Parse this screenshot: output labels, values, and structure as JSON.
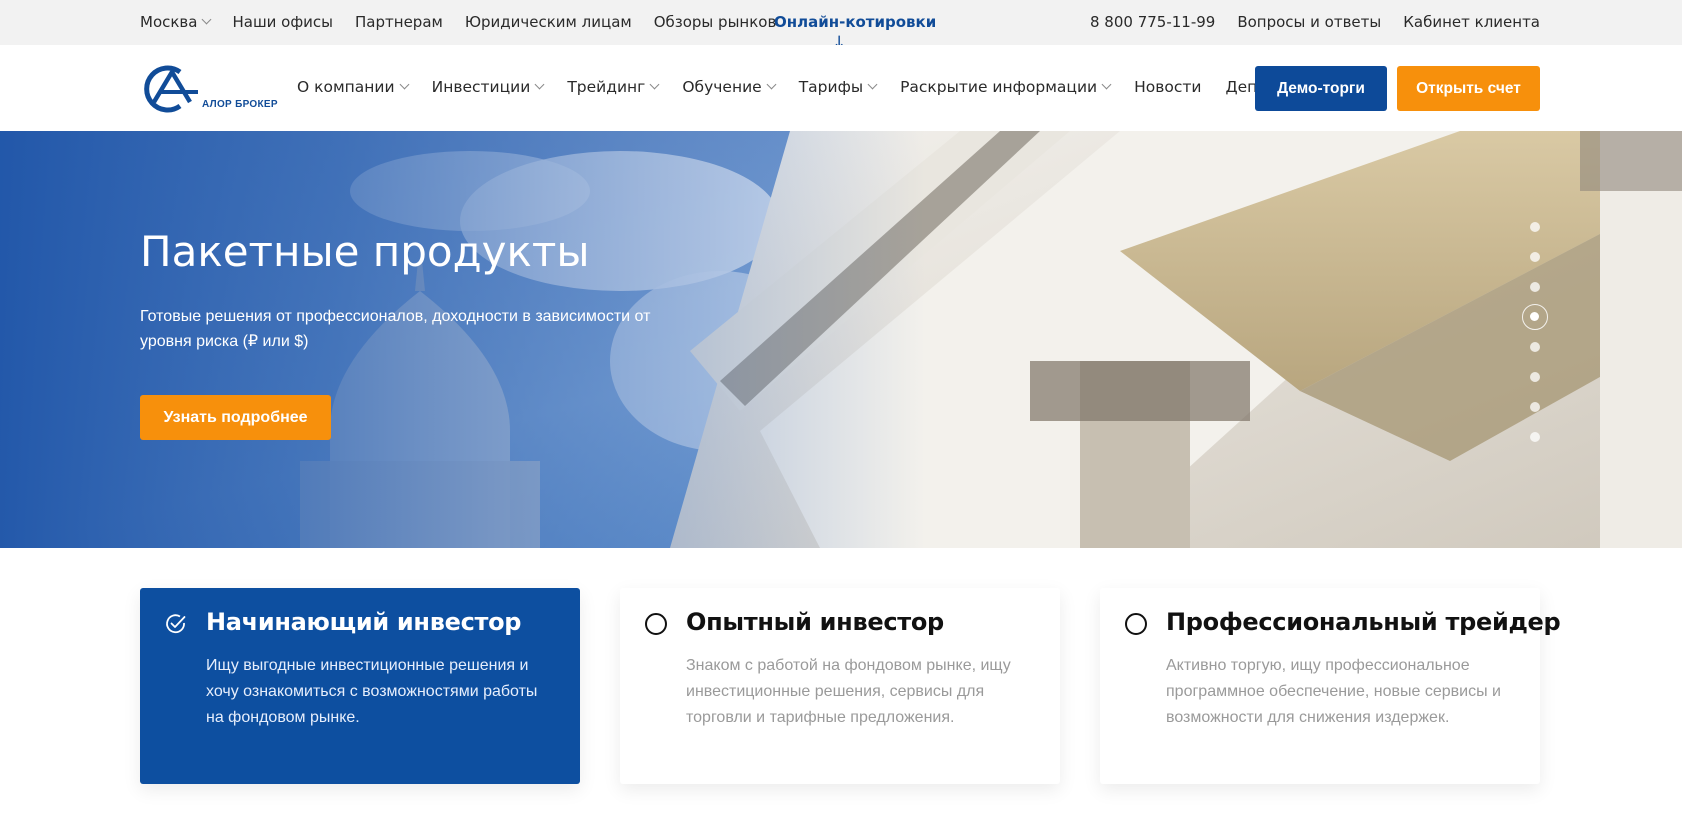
{
  "topbar": {
    "city": "Москва",
    "links": [
      "Наши офисы",
      "Партнерам",
      "Юридическим лицам",
      "Обзоры рынков"
    ],
    "quotes": "Онлайн-котировки",
    "phone": "8 800 775-11-99",
    "faq": "Вопросы и ответы",
    "cabinet": "Кабинет клиента"
  },
  "logo": {
    "text": "АЛОР БРОКЕР"
  },
  "nav": {
    "items": [
      {
        "label": "О компании",
        "dropdown": true
      },
      {
        "label": "Инвестиции",
        "dropdown": true
      },
      {
        "label": "Трейдинг",
        "dropdown": true
      },
      {
        "label": "Обучение",
        "dropdown": true
      },
      {
        "label": "Тарифы",
        "dropdown": true
      },
      {
        "label": "Раскрытие информации",
        "dropdown": true
      },
      {
        "label": "Новости",
        "dropdown": false
      },
      {
        "label": "Депозитарий",
        "dropdown": true
      }
    ],
    "demo_label": "Демо-торги",
    "open_label": "Открыть счет"
  },
  "hero": {
    "title": "Пакетные продукты",
    "subtitle": "Готовые решения от профессионалов, доходности в зависимости от уровня риска (₽ или $)",
    "button_label": "Узнать подробнее",
    "slides_total": 8,
    "active_slide": 4
  },
  "cards": [
    {
      "title": "Начинающий инвестор",
      "desc": "Ищу выгодные инвестиционные решения и хочу ознакомиться с возможностями работы на фондовом рынке.",
      "selected": true
    },
    {
      "title": "Опытный инвестор",
      "desc": "Знаком с работой на фондовом рынке, ищу инвестиционные решения, сервисы для торговли и тарифные предложения.",
      "selected": false
    },
    {
      "title": "Профессиональный трейдер",
      "desc": "Активно торгую, ищу профессиональное программное обеспечение, новые сервисы и возможности для снижения издержек.",
      "selected": false
    }
  ],
  "colors": {
    "brand_blue": "#0d4a99",
    "accent_orange": "#f7900c"
  }
}
